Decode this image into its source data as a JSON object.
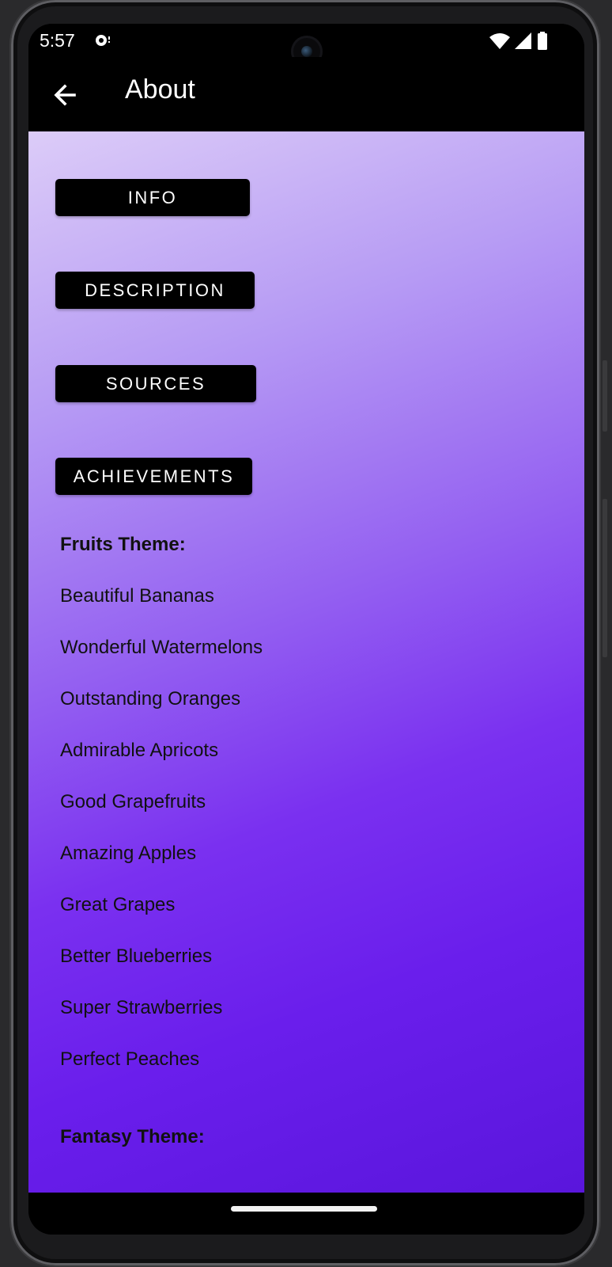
{
  "status_bar": {
    "time": "5:57",
    "icons": [
      "notification-icon",
      "wifi-icon",
      "signal-icon",
      "battery-icon"
    ]
  },
  "app_bar": {
    "title": "About",
    "back_icon": "arrow-left-icon"
  },
  "sections": {
    "info_label": "INFO",
    "description_label": "DESCRIPTION",
    "sources_label": "SOURCES",
    "achievements_label": "ACHIEVEMENTS"
  },
  "achievements": {
    "fruits_heading": "Fruits Theme:",
    "fruits_items": [
      "Beautiful Bananas",
      "Wonderful Watermelons",
      "Outstanding Oranges",
      "Admirable Apricots",
      "Good Grapefruits",
      "Amazing Apples",
      "Great Grapes",
      "Better Blueberries",
      "Super Strawberries",
      "Perfect Peaches"
    ],
    "fantasy_heading": "Fantasy Theme:"
  },
  "colors": {
    "gradient_start": "#dcccf8",
    "gradient_end": "#5a16dc",
    "button_bg": "#000000",
    "button_text": "#ffffff"
  }
}
